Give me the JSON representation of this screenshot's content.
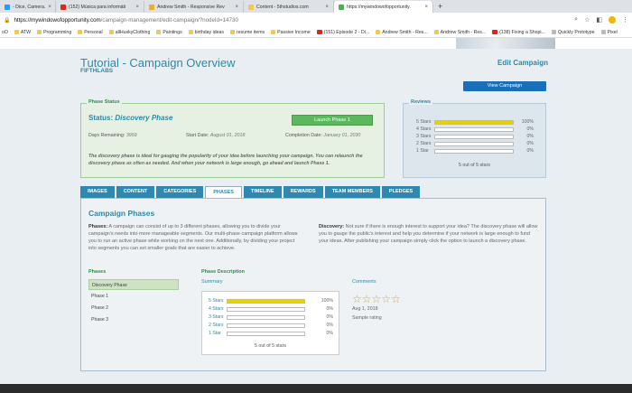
{
  "browser": {
    "tabs": [
      {
        "label": "- Dice, Camera.",
        "favicon_color": "#1da1f2",
        "active": false
      },
      {
        "label": "(152) Música para informáti",
        "favicon_color": "#e62117",
        "active": false
      },
      {
        "label": "Andrew Smith - Responsive Rev",
        "favicon_color": "#e6b422",
        "active": false
      },
      {
        "label": "Content - 5thstudios.com",
        "favicon_color": "#f2c94c",
        "active": false
      },
      {
        "label": "https://mywindowofopportunity.",
        "favicon_color": "#4caf50",
        "active": true
      }
    ],
    "close_glyph": "×",
    "new_tab_glyph": "+",
    "url_host": "https://mywindowofopportunity.com",
    "url_path": "/campaign-management/edit-campaign/?nodeId=14730",
    "bookmarks": [
      {
        "label": "oO",
        "icon": "none"
      },
      {
        "label": "ATW",
        "icon": "folder"
      },
      {
        "label": "Programming",
        "icon": "folder"
      },
      {
        "label": "Personal",
        "icon": "folder"
      },
      {
        "label": "allHuskyClothing",
        "icon": "folder"
      },
      {
        "label": "Paintings",
        "icon": "folder"
      },
      {
        "label": "birthday ideas",
        "icon": "folder"
      },
      {
        "label": "resume items",
        "icon": "folder"
      },
      {
        "label": "Passive Income",
        "icon": "folder"
      },
      {
        "label": "(151) Episode 2 - Di...",
        "icon": "youtube"
      },
      {
        "label": "Andrew Smith - Res...",
        "icon": "folder"
      },
      {
        "label": "Andrew Smith - Res...",
        "icon": "folder"
      },
      {
        "label": "(138) Fixing a Shopi...",
        "icon": "youtube"
      },
      {
        "label": "Quickly Prototype",
        "icon": "generic"
      },
      {
        "label": "Pixel",
        "icon": "generic"
      }
    ]
  },
  "header": {
    "title": "Tutorial - Campaign Overview",
    "subtitle": "FIFTHLABS",
    "edit_link": "Edit Campaign",
    "view_button": "View Campaign"
  },
  "phase_status": {
    "legend": "Phase Status",
    "status_label": "Status:",
    "status_value": "Discovery Phase",
    "launch_button": "Launch Phase 1",
    "days_remaining_label": "Days Remaining:",
    "days_remaining_value": "3959",
    "start_date_label": "Start Date:",
    "start_date_value": "August 01, 2018",
    "completion_date_label": "Completion Date:",
    "completion_date_value": "January 01, 2030",
    "description": "The discovery phase is ideal for gauging the popularity of your idea before launching your campaign. You can relaunch the discovery phase as often as needed. And when your network is large enough, go ahead and launch Phase 1."
  },
  "reviews": {
    "legend": "Reviews",
    "rows": [
      {
        "label": "5 Stars",
        "pct": "100%",
        "fill": 1.0
      },
      {
        "label": "4 Stars",
        "pct": "0%",
        "fill": 0
      },
      {
        "label": "3 Stars",
        "pct": "0%",
        "fill": 0
      },
      {
        "label": "2 Stars",
        "pct": "0%",
        "fill": 0
      },
      {
        "label": "1 Star",
        "pct": "0%",
        "fill": 0
      }
    ],
    "summary": "5 out of 5 stars",
    "bar_color": "#e6d200"
  },
  "tabs": [
    {
      "label": "IMAGES",
      "active": false
    },
    {
      "label": "CONTENT",
      "active": false
    },
    {
      "label": "CATEGORIES",
      "active": false
    },
    {
      "label": "PHASES",
      "active": true
    },
    {
      "label": "TIMELINE",
      "active": false
    },
    {
      "label": "REWARDS",
      "active": false
    },
    {
      "label": "TEAM MEMBERS",
      "active": false
    },
    {
      "label": "PLEDGES",
      "active": false
    }
  ],
  "phases_panel": {
    "title": "Campaign Phases",
    "left_head": "Phases:",
    "left_text": "A campaign can consist of up to 3 different phases, allowing you to divide your campaign's needs into more manageable segments. Our multi-phase campaign platform allows you to run an active phase while working on the next one. Additionally, by dividing your project into segments you can set smaller goals that are easier to achieve.",
    "right_head": "Discovery:",
    "right_text": "Not sure if there is enough interest to support your idea? The discovery phase will allow you to gauge the public's interest and help you determine if your network is large enough to fund your ideas. After publishing your campaign simply click the option to launch a discovery phase.",
    "phases_heading": "Phases",
    "phase_list": [
      "Discovery Phase",
      "Phase 1",
      "Phase 2",
      "Phase 3"
    ],
    "description_heading": "Phase Description",
    "summary_link": "Summary",
    "comments_link": "Comments",
    "comment_stars": "☆☆☆☆☆",
    "comment_date": "Aug 1, 2018",
    "comment_text": "Sample rating"
  }
}
